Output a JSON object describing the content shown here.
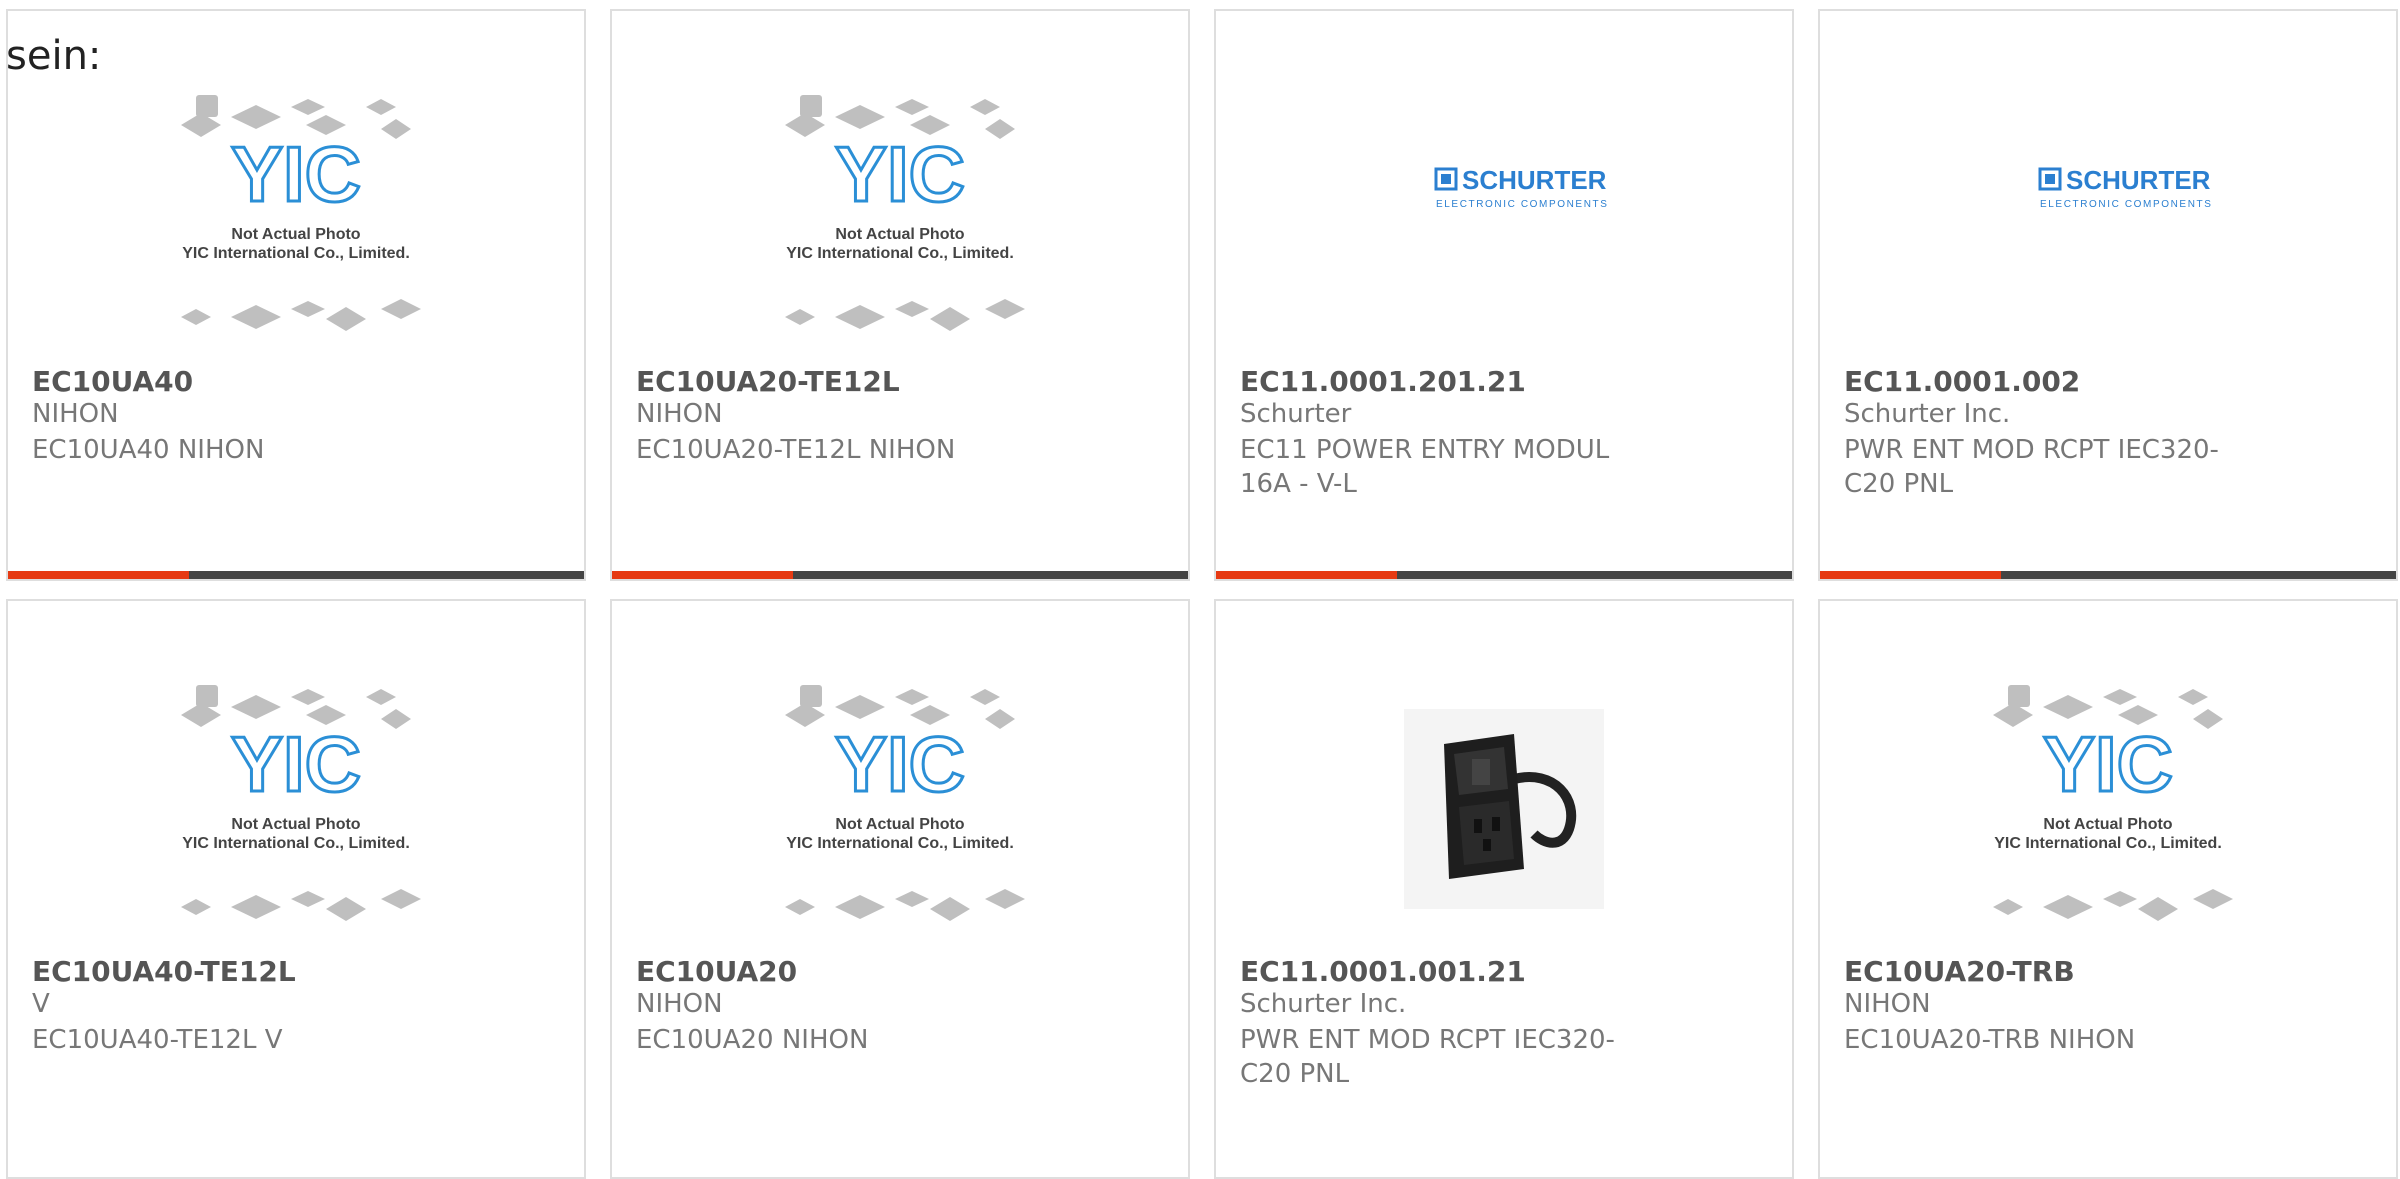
{
  "lead_text": "sein:",
  "accent_color": "#e63a13",
  "bar_color": "#444444",
  "placeholder": {
    "line1": "Not Actual Photo",
    "line2": "YIC International Co., Limited.",
    "logo": "YIC"
  },
  "brand_logo": {
    "name": "SCHURTER",
    "tagline": "ELECTRONIC COMPONENTS"
  },
  "products": [
    {
      "part": "EC10UA40",
      "manufacturer": "NIHON",
      "description": "EC10UA40 NIHON",
      "image": "yic-placeholder"
    },
    {
      "part": "EC10UA20-TE12L",
      "manufacturer": "NIHON",
      "description": "EC10UA20-TE12L NIHON",
      "image": "yic-placeholder"
    },
    {
      "part": "EC11.0001.201.21",
      "manufacturer": "Schurter",
      "description": "EC11 POWER ENTRY MODUL 16A - V-L",
      "image": "schurter-logo"
    },
    {
      "part": "EC11.0001.002",
      "manufacturer": "Schurter Inc.",
      "description": "PWR ENT MOD RCPT IEC320-C20 PNL",
      "image": "schurter-logo"
    },
    {
      "part": "EC10UA40-TE12L",
      "manufacturer": "V",
      "description": "EC10UA40-TE12L V",
      "image": "yic-placeholder"
    },
    {
      "part": "EC10UA20",
      "manufacturer": "NIHON",
      "description": "EC10UA20 NIHON",
      "image": "yic-placeholder"
    },
    {
      "part": "EC11.0001.001.21",
      "manufacturer": "Schurter Inc.",
      "description": "PWR ENT MOD RCPT IEC320-C20 PNL",
      "image": "power-entry-module-photo"
    },
    {
      "part": "EC10UA20-TRB",
      "manufacturer": "NIHON",
      "description": "EC10UA20-TRB NIHON",
      "image": "yic-placeholder"
    }
  ]
}
